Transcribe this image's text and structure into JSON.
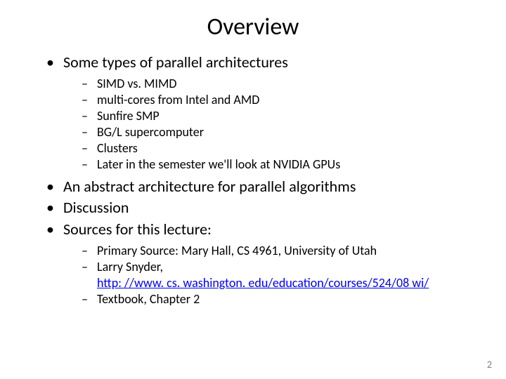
{
  "title": "Overview",
  "bullets": {
    "b1": {
      "text": "Some types of parallel architectures"
    },
    "b1_sub": {
      "s1": "SIMD vs. MIMD",
      "s2": "multi-cores from Intel and AMD",
      "s3": "Sunfire SMP",
      "s4": "BG/L supercomputer",
      "s5": "Clusters",
      "s6": "Later in the semester we'll look at NVIDIA GPUs"
    },
    "b2": {
      "text": "An abstract architecture for parallel algorithms"
    },
    "b3": {
      "text": "Discussion"
    },
    "b4": {
      "text": "Sources for this lecture:"
    },
    "b4_sub": {
      "s1": "Primary Source: Mary Hall, CS 4961, University of Utah",
      "s2_prefix": "Larry Snyder, ",
      "s2_link": "http: //www. cs. washington. edu/education/courses/524/08 wi/",
      "s3": "Textbook, Chapter 2"
    }
  },
  "page_number": "2"
}
